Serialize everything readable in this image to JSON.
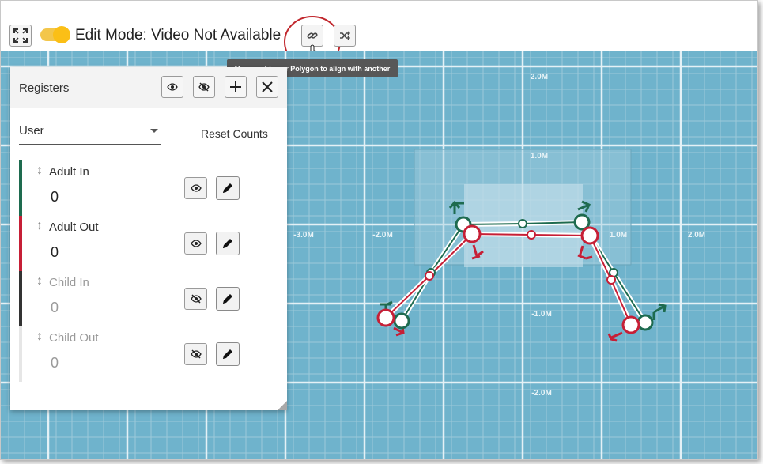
{
  "toolbar": {
    "title": "Edit Mode: Video Not Available",
    "edit_toggle_on": true,
    "tooltip": "Moves a Line or Polygon to align with another",
    "icons": [
      "fullscreen-icon",
      "link-icon",
      "shuffle-icon"
    ]
  },
  "map": {
    "y_labels": [
      "2.0M",
      "1.0M",
      "-1.0M",
      "-2.0M"
    ],
    "x_labels": [
      "-3.0M",
      "-2.0M",
      "1.0M",
      "2.0M"
    ],
    "line_colors": {
      "in": "#1e6b4f",
      "out": "#c61f36"
    }
  },
  "panel": {
    "title": "Registers",
    "select_value": "User",
    "reset_label": "Reset Counts",
    "registers": [
      {
        "name": "Adult In",
        "count": "0",
        "color": "#1e6b4f",
        "visible": true,
        "active": true
      },
      {
        "name": "Adult Out",
        "count": "0",
        "color": "#c61f36",
        "visible": true,
        "active": true
      },
      {
        "name": "Child In",
        "count": "0",
        "color": "#333333",
        "visible": false,
        "active": false
      },
      {
        "name": "Child Out",
        "count": "0",
        "color": "#e6e6e6",
        "visible": false,
        "active": false
      }
    ]
  }
}
